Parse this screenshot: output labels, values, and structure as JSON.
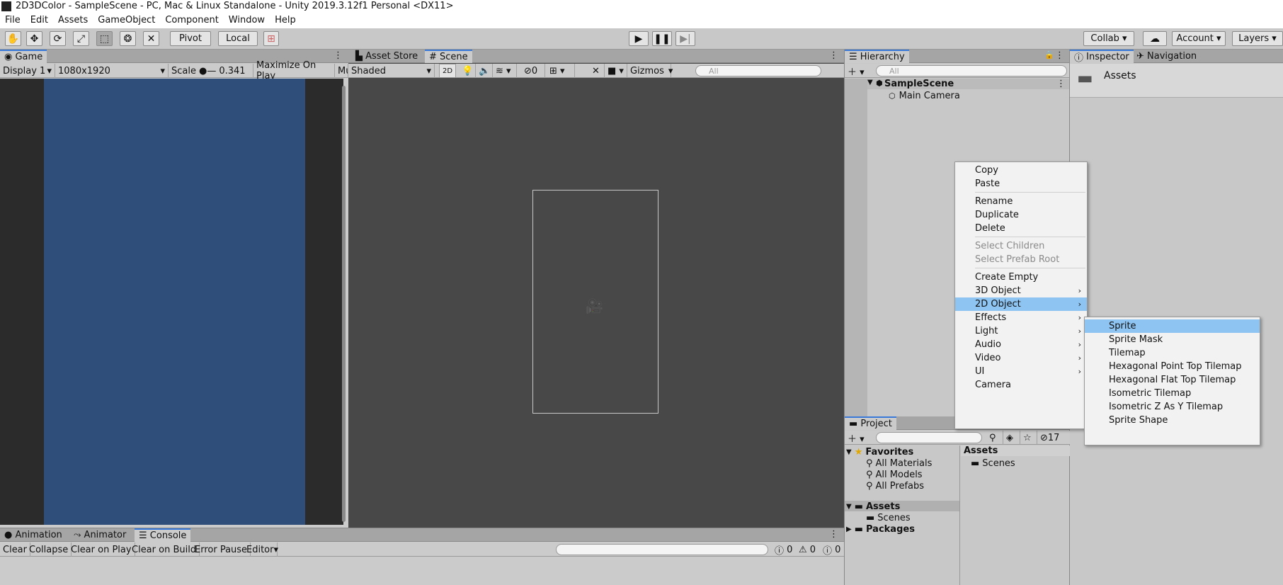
{
  "window": {
    "title": "2D3DColor - SampleScene - PC, Mac & Linux Standalone - Unity 2019.3.12f1 Personal <DX11>"
  },
  "menubar": [
    "File",
    "Edit",
    "Assets",
    "GameObject",
    "Component",
    "Window",
    "Help"
  ],
  "toolbar": {
    "pivot": "Pivot",
    "local": "Local",
    "collab": "Collab",
    "account": "Account",
    "layers": "Layers"
  },
  "game": {
    "tab": "Game",
    "display": "Display 1",
    "resolution": "1080x1920",
    "scale_label": "Scale",
    "scale_value": "0.341",
    "maximize": "Maximize On Play",
    "mute": "Mu",
    "background_color": "#2f4e7a"
  },
  "scene": {
    "tab_asset_store": "Asset Store",
    "tab_scene": "Scene",
    "shading": "Shaded",
    "mode_2d": "2D",
    "hidden_count": "0",
    "gizmos": "Gizmos",
    "search_placeholder": "All"
  },
  "hierarchy": {
    "tab": "Hierarchy",
    "search_placeholder": "All",
    "scene": "SampleScene",
    "items": [
      "Main Camera"
    ]
  },
  "inspector": {
    "tab": "Inspector",
    "tab_nav": "Navigation",
    "title": "Assets"
  },
  "context_menu": {
    "items": [
      {
        "label": "Copy",
        "state": "normal"
      },
      {
        "label": "Paste",
        "state": "normal"
      },
      {
        "label": "Rename",
        "state": "normal"
      },
      {
        "label": "Duplicate",
        "state": "normal"
      },
      {
        "label": "Delete",
        "state": "normal"
      },
      {
        "label": "Select Children",
        "state": "disabled"
      },
      {
        "label": "Select Prefab Root",
        "state": "disabled"
      },
      {
        "label": "Create Empty",
        "state": "normal"
      },
      {
        "label": "3D Object",
        "state": "submenu"
      },
      {
        "label": "2D Object",
        "state": "highlighted"
      },
      {
        "label": "Effects",
        "state": "submenu"
      },
      {
        "label": "Light",
        "state": "submenu"
      },
      {
        "label": "Audio",
        "state": "submenu"
      },
      {
        "label": "Video",
        "state": "submenu"
      },
      {
        "label": "UI",
        "state": "submenu"
      },
      {
        "label": "Camera",
        "state": "normal"
      }
    ]
  },
  "submenu": {
    "items": [
      "Sprite",
      "Sprite Mask",
      "Tilemap",
      "Hexagonal Point Top Tilemap",
      "Hexagonal Flat Top Tilemap",
      "Isometric Tilemap",
      "Isometric Z As Y Tilemap",
      "Sprite Shape"
    ],
    "highlighted": "Sprite"
  },
  "project": {
    "tab": "Project",
    "hidden_count": "17",
    "favorites": "Favorites",
    "fav_items": [
      "All Materials",
      "All Models",
      "All Prefabs"
    ],
    "assets": "Assets",
    "assets_children": [
      "Scenes"
    ],
    "packages": "Packages",
    "right_header": "Assets",
    "right_items": [
      "Scenes"
    ]
  },
  "console": {
    "tabs": [
      "Animation",
      "Animator",
      "Console"
    ],
    "buttons": [
      "Clear",
      "Collapse",
      "Clear on Play",
      "Clear on Build",
      "Error Pause",
      "Editor"
    ],
    "counts": [
      "0",
      "0",
      "0"
    ]
  }
}
